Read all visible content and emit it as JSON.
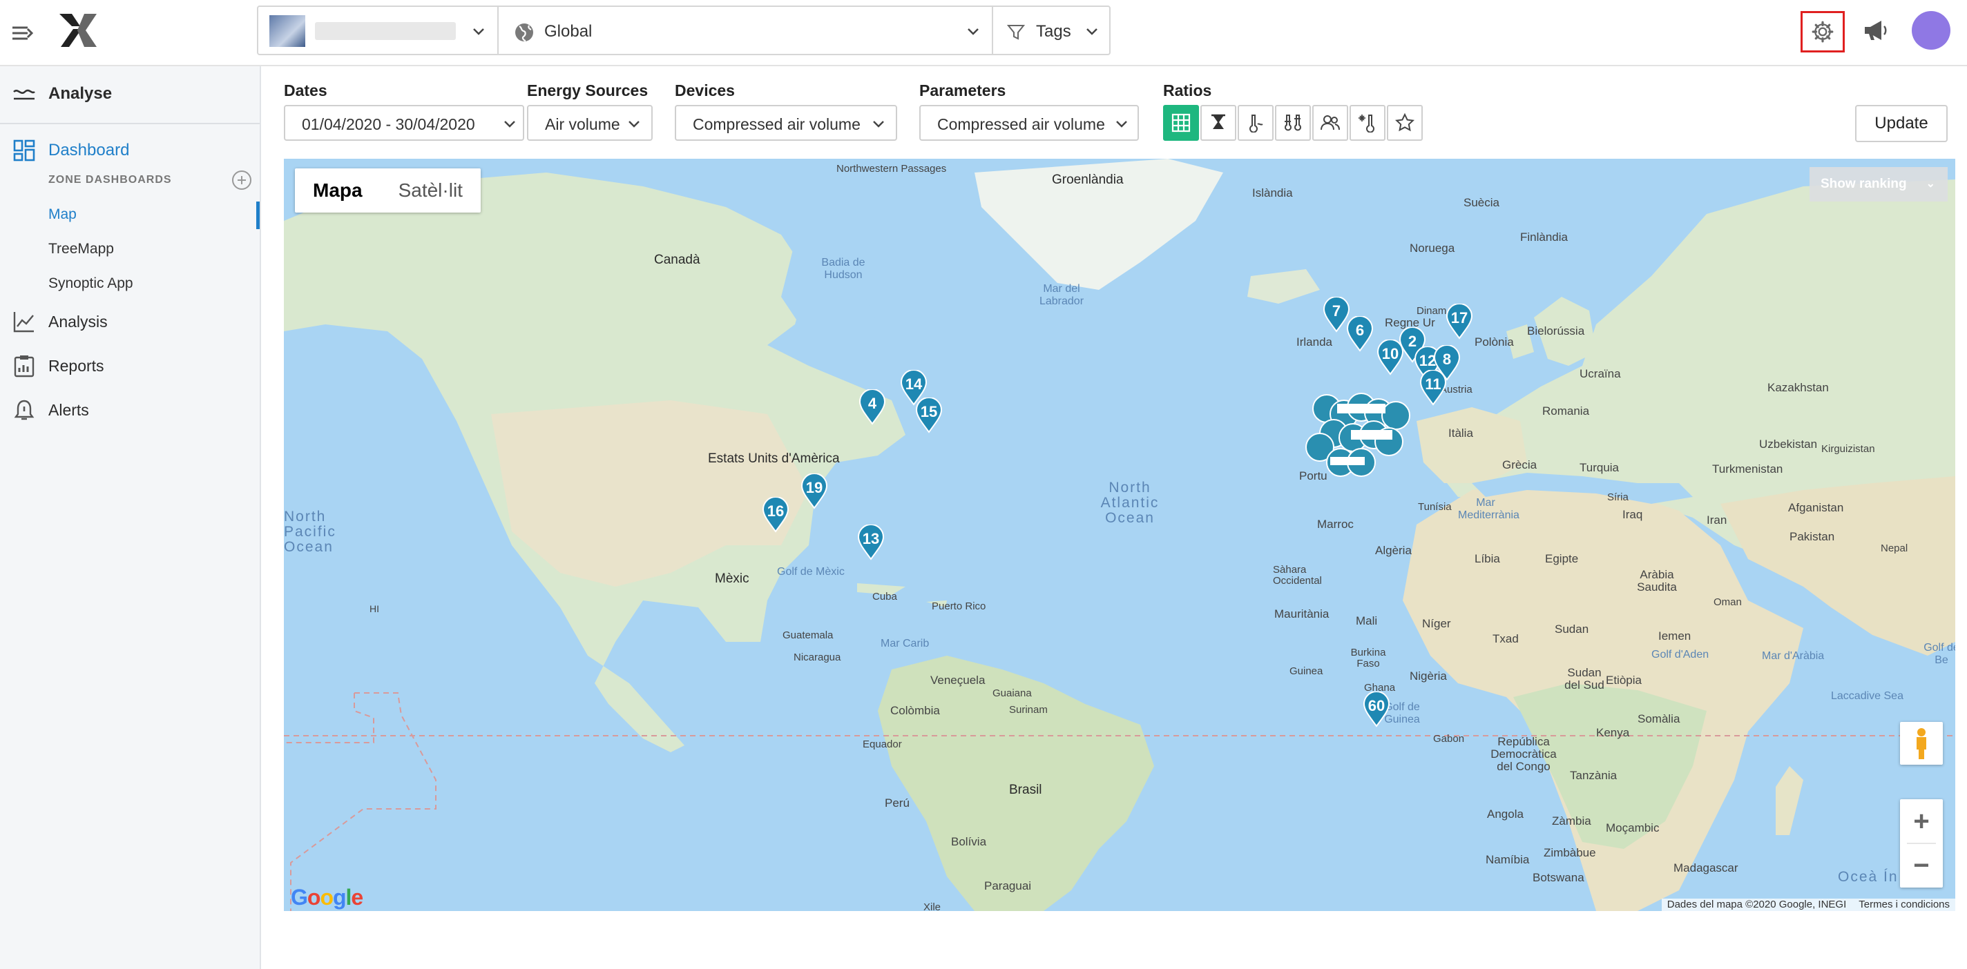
{
  "topbar": {
    "global_label": "Global",
    "tags_label": "Tags"
  },
  "sidebar": {
    "analyse_label": "Analyse",
    "dashboard_label": "Dashboard",
    "zone_dashboards_label": "ZONE DASHBOARDS",
    "sub_items": [
      "Map",
      "TreeMapp",
      "Synoptic App"
    ],
    "analysis_label": "Analysis",
    "reports_label": "Reports",
    "alerts_label": "Alerts"
  },
  "filters": {
    "dates_label": "Dates",
    "dates_value": "01/04/2020 - 30/04/2020",
    "energy_label": "Energy Sources",
    "energy_value": "Air volume",
    "devices_label": "Devices",
    "devices_value": "Compressed air volume",
    "parameters_label": "Parameters",
    "parameters_value": "Compressed air volume",
    "ratios_label": "Ratios",
    "update_label": "Update"
  },
  "map": {
    "type_map": "Mapa",
    "type_satellite": "Satèl·lit",
    "show_ranking": "Show ranking",
    "attribution": "Dades del mapa ©2020 Google, INEGI",
    "terms": "Termes i condicions",
    "pins": [
      "7",
      "6",
      "17",
      "10",
      "2",
      "12",
      "8",
      "11",
      "14",
      "4",
      "15",
      "19",
      "16",
      "13",
      "60"
    ],
    "labels": {
      "northwest_passages": "Northwestern Passages",
      "groenlandia": "Groenlàndia",
      "islandia": "Islàndia",
      "suecia": "Suècia",
      "finlandia": "Finlàndia",
      "noruega": "Noruega",
      "canada": "Canadà",
      "badia_hudson": "Badia de Hudson",
      "mar_labrador": "Mar del Labrador",
      "irlanda": "Irlanda",
      "polonia": "Polònia",
      "bielorussia": "Bielorússia",
      "ucraina": "Ucraïna",
      "kazakhstan": "Kazakhstan",
      "estats_units": "Estats Units d'Amèrica",
      "austria": "Àustria",
      "romania": "Romania",
      "italia": "Itàlia",
      "grecia": "Grècia",
      "turquia": "Turquia",
      "uzbekistan": "Uzbekistan",
      "kirguizistan": "Kirguizistan",
      "turkmenistan": "Turkmenistan",
      "north_atlantic": "North Atlantic Ocean",
      "portugal": "Portu",
      "marroc": "Marroc",
      "tunisia": "Tunísia",
      "mar_mediterrania": "Mar Mediterrània",
      "siria": "Síria",
      "iraq": "Iraq",
      "iran": "Iran",
      "afganistan": "Afganistan",
      "pakistan": "Pakistan",
      "north_pacific": "North Pacific Ocean",
      "algeria": "Algèria",
      "libia": "Líbia",
      "egipte": "Egipte",
      "mexic": "Mèxic",
      "golf_mexic": "Golf de Mèxic",
      "cuba": "Cuba",
      "puerto_rico": "Puerto Rico",
      "sahara": "Sàhara Occidental",
      "arabia": "Aràbia Saudita",
      "oman": "Oman",
      "nepal": "Nepal",
      "mauritania": "Mauritània",
      "mali": "Mali",
      "niger": "Níger",
      "txad": "Txad",
      "sudan": "Sudan",
      "iemen": "Iemen",
      "golf_aden": "Golf d'Aden",
      "mar_arabia": "Mar d'Aràbia",
      "golf_bengala": "Golf de Be",
      "guatemala": "Guatemala",
      "nicaragua": "Nicaragua",
      "mar_carib": "Mar Carib",
      "burkina": "Burkina Faso",
      "guinea": "Guinea",
      "ghana": "Ghana",
      "nigeria": "Nigèria",
      "golf_guinea": "Golf de Guinea",
      "sudan_sud": "Sudan del Sud",
      "etiopia": "Etiòpia",
      "laccadive": "Laccadive Sea",
      "veneçuela": "Veneçuela",
      "guaiana": "Guaiana",
      "surinam": "Surinam",
      "colombia": "Colòmbia",
      "equador": "Equador",
      "somalia": "Somàlia",
      "kenya": "Kenya",
      "gabon": "Gabon",
      "rd_congo": "República Democràtica del Congo",
      "tanzania": "Tanzània",
      "brasil": "Brasil",
      "peru": "Perú",
      "bolivia": "Bolívia",
      "angola": "Angola",
      "zambia": "Zàmbia",
      "moçambic": "Moçambic",
      "zimbabwe": "Zimbàbue",
      "namibia": "Namíbia",
      "botswana": "Botswana",
      "madagascar": "Madagascar",
      "paraguai": "Paraguai",
      "ocea_ind": "Oceà Ín",
      "xile": "Xile",
      "hi": "HI",
      "dinam": "Dinam",
      "regne_unit": "Regne Ur"
    }
  }
}
